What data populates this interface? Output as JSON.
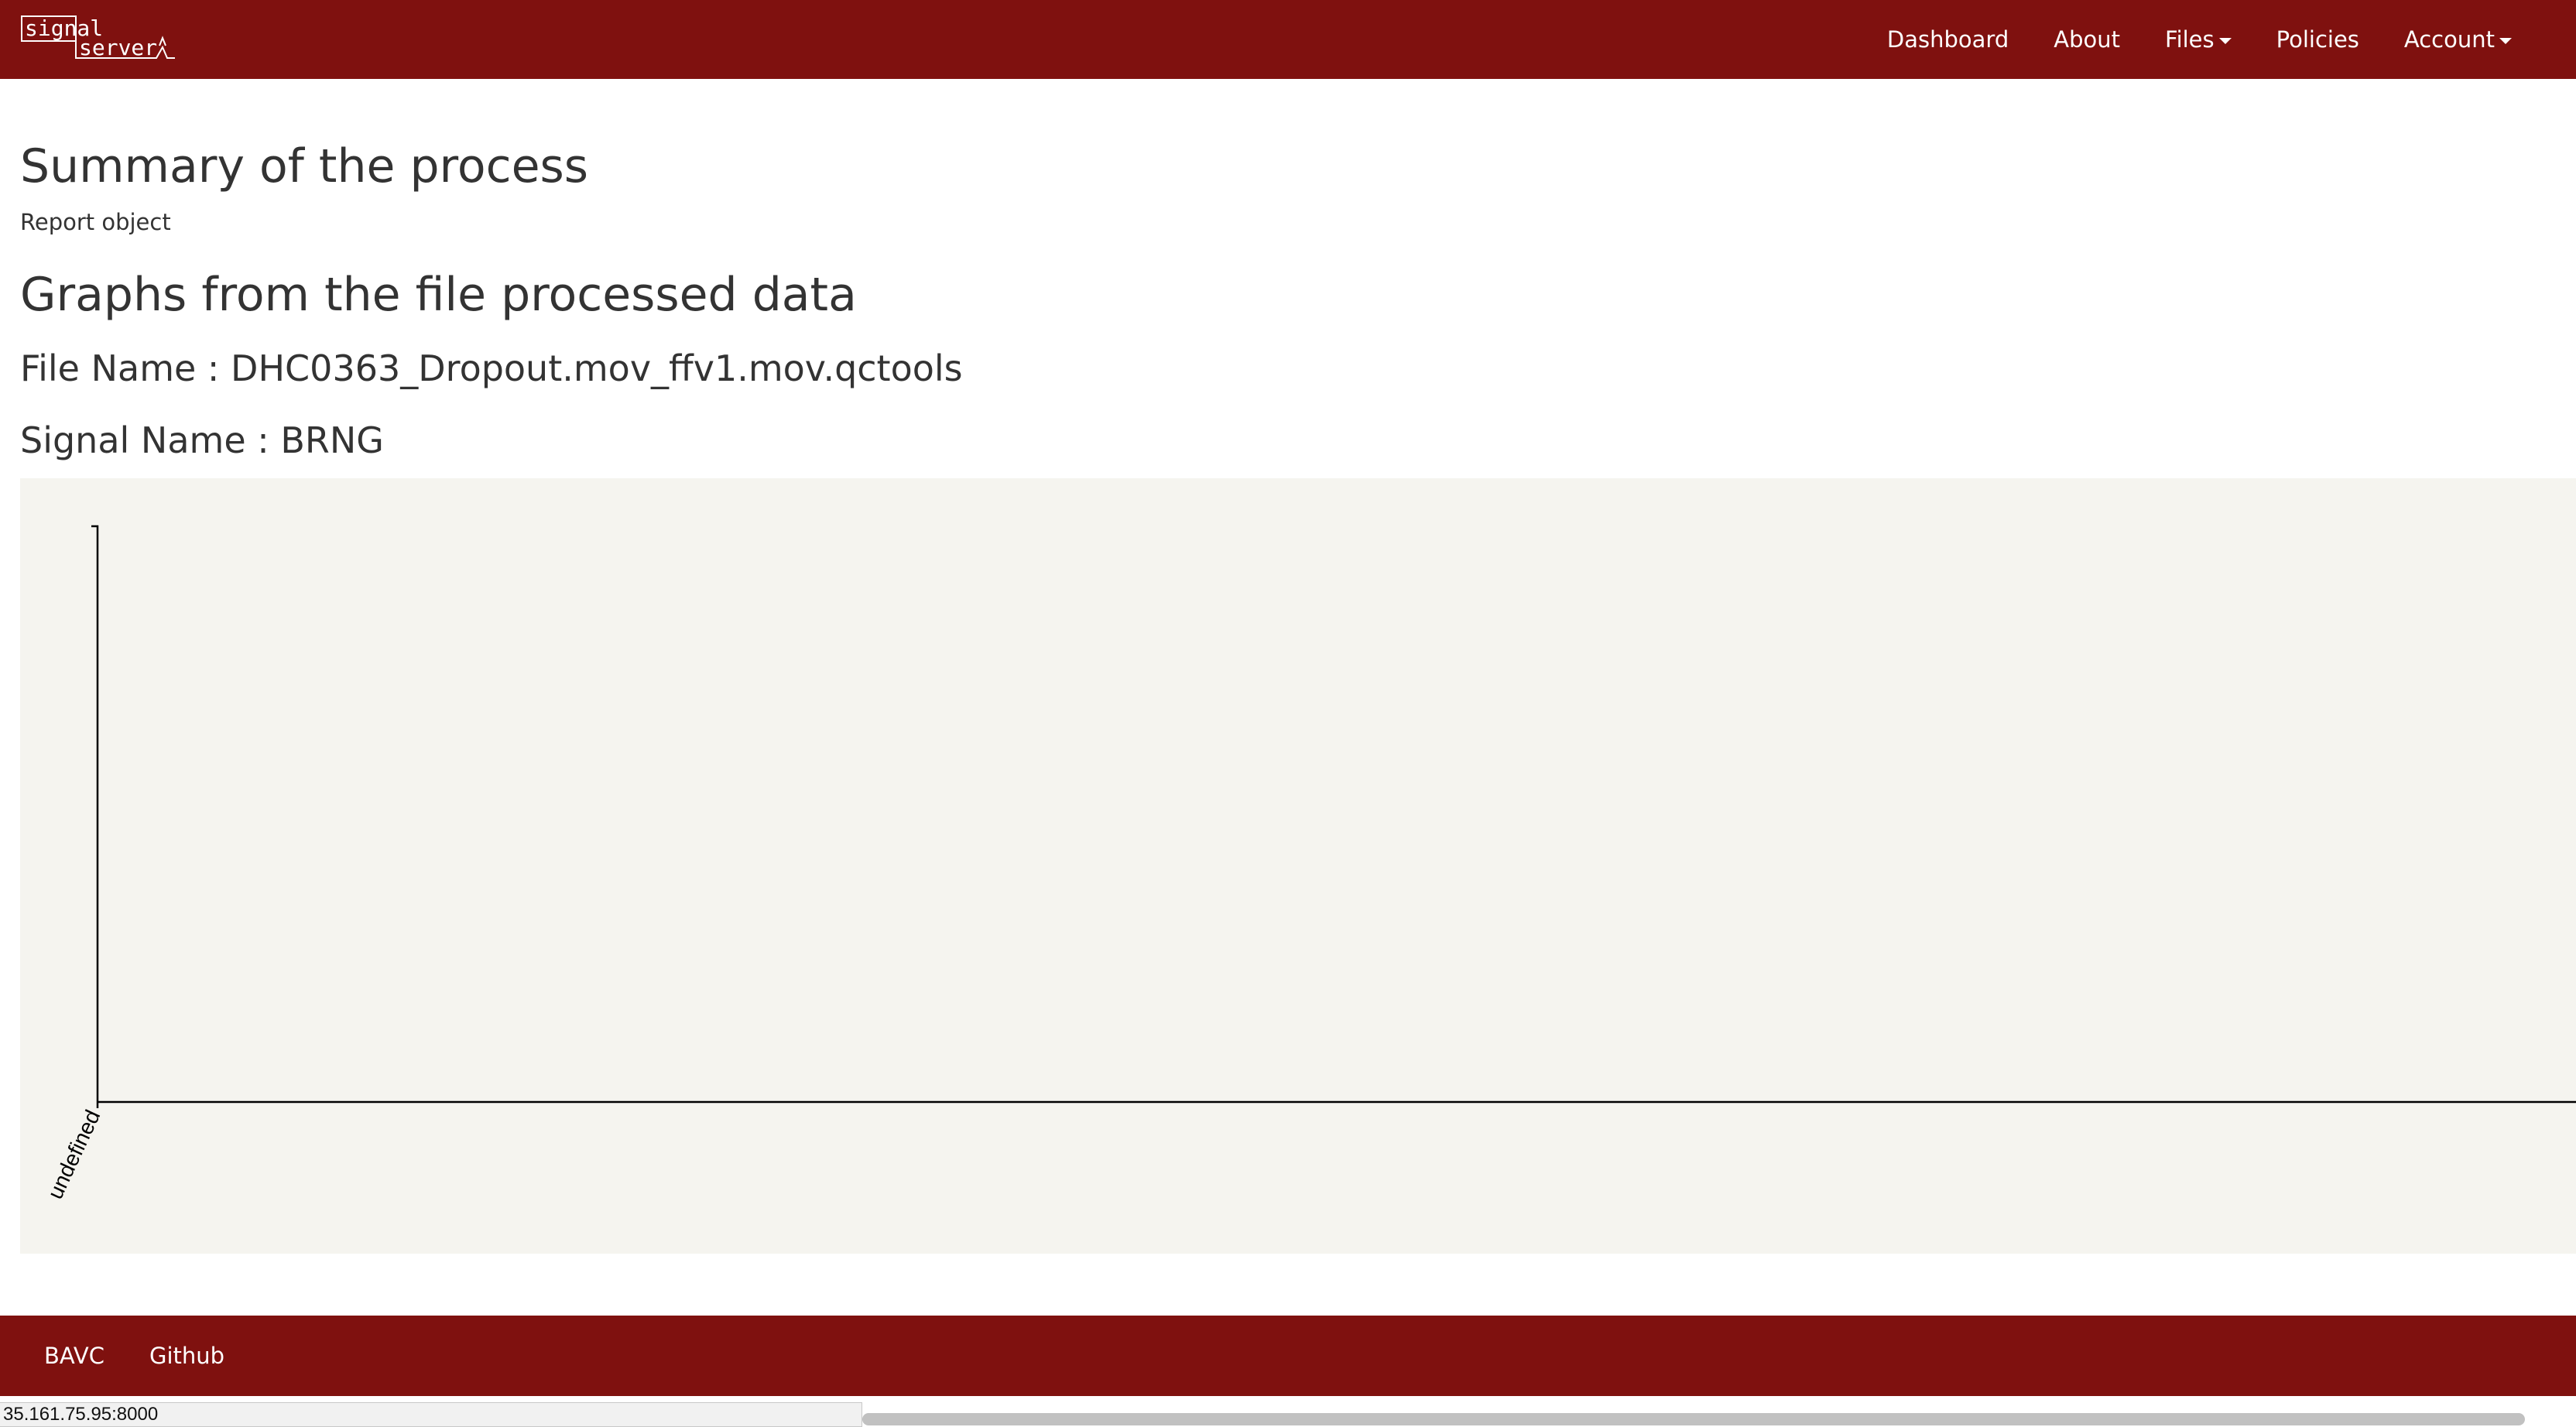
{
  "navbar": {
    "brand_top": "signal",
    "brand_bottom": "server",
    "links": [
      {
        "label": "Dashboard",
        "dropdown": false
      },
      {
        "label": "About",
        "dropdown": false
      },
      {
        "label": "Files",
        "dropdown": true
      },
      {
        "label": "Policies",
        "dropdown": false
      },
      {
        "label": "Account",
        "dropdown": true
      }
    ]
  },
  "main": {
    "summary_heading": "Summary of the process",
    "report_text": "Report object",
    "graphs_heading": "Graphs from the file processed data",
    "file_name": "File Name : DHC0363_Dropout.mov_ffv1.mov.qctools",
    "signal_name": "Signal Name : BRNG"
  },
  "chart_data": {
    "type": "line",
    "x_tick_labels": [
      "undefined"
    ],
    "series": []
  },
  "footer": {
    "links": [
      "BAVC",
      "Github"
    ]
  },
  "browser": {
    "status_url": "35.161.75.95:8000"
  },
  "colors": {
    "brand": "#7f110f",
    "chart_background": "#f5f4ef"
  }
}
